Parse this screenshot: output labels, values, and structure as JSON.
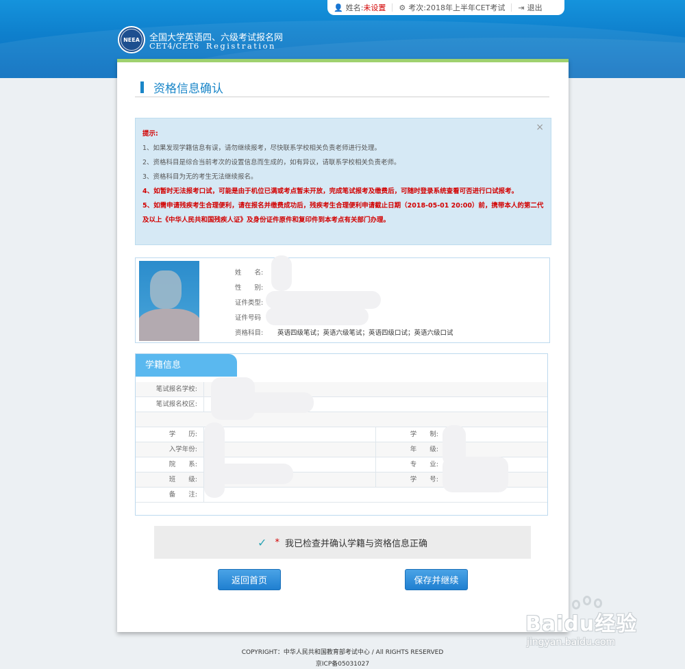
{
  "topbar": {
    "name_label": "姓名:",
    "name_value": "未设置",
    "exam_label": "考次:",
    "exam_value": "2018年上半年CET考试",
    "logout_label": "退出"
  },
  "header": {
    "logo_text": "NEEA",
    "title": "全国大学英语四、六级考试报名网",
    "subtitle": "CET4/CET6",
    "subtitle2": "Registration"
  },
  "section": {
    "title": "资格信息确认"
  },
  "notice": {
    "close": "×",
    "heading": "提示:",
    "items": [
      "1、如果发现学籍信息有误，请勿继续报考，尽快联系学校相关负责老师进行处理。",
      "2、资格科目是综合当前考次的设置信息而生成的，如有异议，请联系学校相关负责老师。",
      "3、资格科目为无的考生无法继续报名。",
      "4、如暂时无法报考口试，可能是由于机位已满或考点暂未开放，完成笔试报考及缴费后，可随时登录系统查看可否进行口试报考。",
      "5、如需申请残疾考生合理便利，请在报名并缴费成功后，残疾考生合理便利申请截止日期（2018-05-01 20:00）前，携带本人的第二代及以上《中华人民共和国残疾人证》及身份证件原件和复印件到本考点有关部门办理。"
    ]
  },
  "profile": {
    "name_label": "姓　　名:",
    "gender_label": "性　　别:",
    "idtype_label": "证件类型:",
    "idno_label": "证件号码",
    "subjects_label": "资格科目:",
    "subjects_value": "英语四级笔试；英语六级笔试；英语四级口试；英语六级口试"
  },
  "school": {
    "tab": "学籍信息",
    "school_label": "笔试报名学校:",
    "campus_label": "笔试报名校区:",
    "education_label": "学　　历:",
    "duration_label": "学　　制:",
    "year_label": "入学年份:",
    "grade_label": "年　　级:",
    "dept_label": "院　　系:",
    "major_label": "专　　业:",
    "class_label": "班　　级:",
    "studentno_label": "学　　号:",
    "remark_label": "备　　注:"
  },
  "confirm": {
    "check": "✓",
    "star": "*",
    "text": "我已检查并确认学籍与资格信息正确"
  },
  "buttons": {
    "back": "返回首页",
    "save": "保存并继续"
  },
  "footer": {
    "copyright": "COPYRIGHT：中华人民共和国教育部考试中心 / All RIGHTS RESERVED",
    "icp": "京ICP备05031027"
  },
  "watermark": {
    "main": "Baidu经验",
    "sub": "jingyan.baidu.com"
  },
  "colors": {
    "accent": "#1a86c8",
    "warning": "#d20000",
    "header_blue": "#0e7fcc",
    "top_border_green": "#9fd16f"
  }
}
